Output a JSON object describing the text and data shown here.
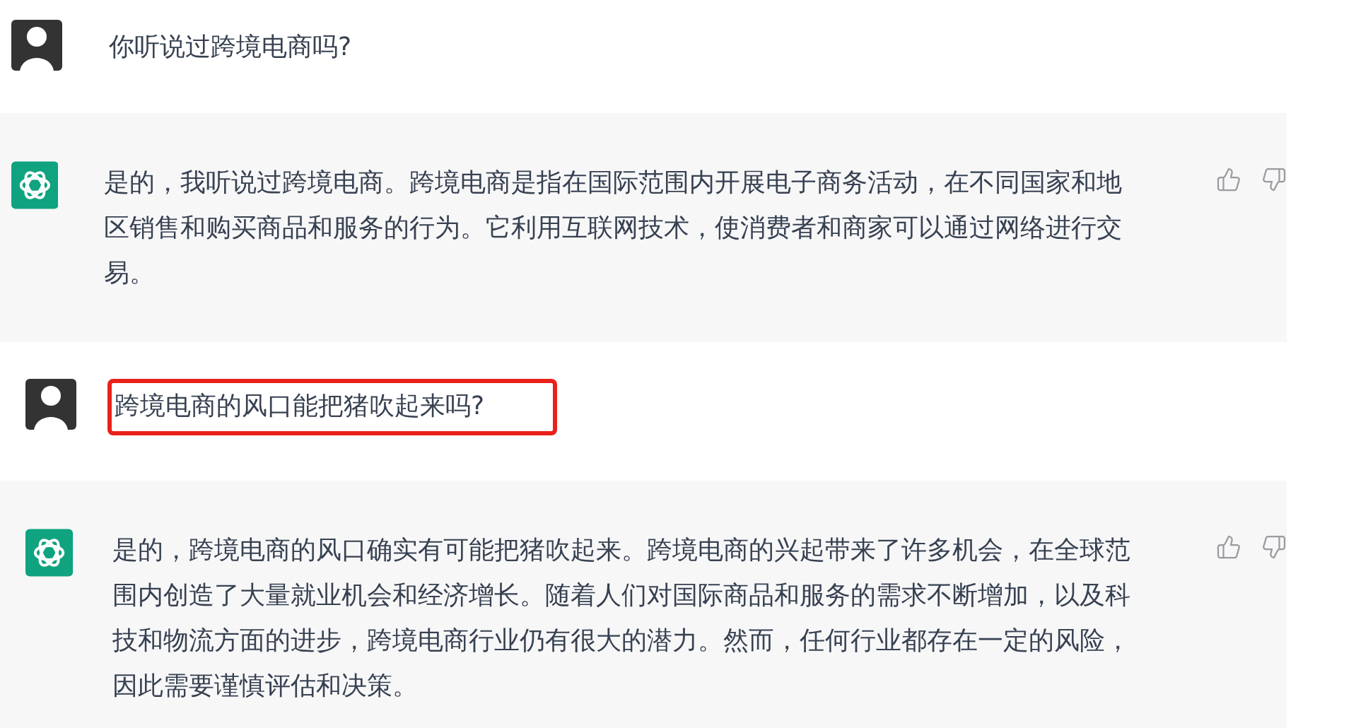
{
  "messages": [
    {
      "kind": "user",
      "text": "你听说过跨境电商吗?",
      "highlighted": false
    },
    {
      "kind": "assistant",
      "text": "是的，我听说过跨境电商。跨境电商是指在国际范围内开展电子商务活动，在不同国家和地区销售和购买商品和服务的行为。它利用互联网技术，使消费者和商家可以通过网络进行交易。"
    },
    {
      "kind": "user",
      "text": "跨境电商的风口能把猪吹起来吗?",
      "highlighted": true
    },
    {
      "kind": "assistant",
      "text": "是的，跨境电商的风口确实有可能把猪吹起来。跨境电商的兴起带来了许多机会，在全球范围内创造了大量就业机会和经济增长。随着人们对国际商品和服务的需求不断增加，以及科技和物流方面的进步，跨境电商行业仍有很大的潜力。然而，任何行业都存在一定的风险，因此需要谨慎评估和决策。"
    }
  ]
}
